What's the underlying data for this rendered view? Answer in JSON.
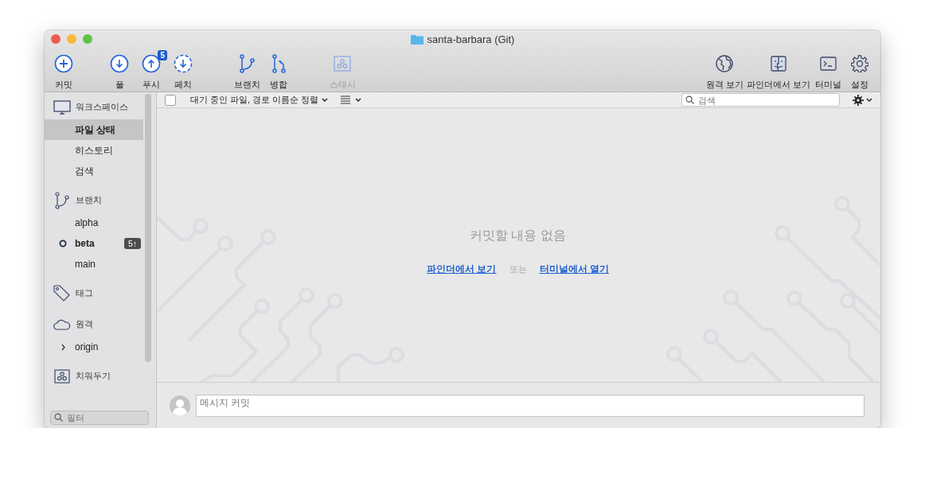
{
  "window": {
    "title": "santa-barbara (Git)"
  },
  "toolbar": {
    "left_groups": [
      [
        {
          "kind": "commit",
          "label": "커밋",
          "disabled": false
        }
      ],
      [
        {
          "kind": "pull",
          "label": "풀",
          "disabled": false
        },
        {
          "kind": "push",
          "label": "푸시",
          "badge": "5",
          "disabled": false
        },
        {
          "kind": "fetch",
          "label": "페치",
          "disabled": false
        }
      ],
      [
        {
          "kind": "branch",
          "label": "브랜치",
          "disabled": false
        },
        {
          "kind": "merge",
          "label": "병합",
          "disabled": false
        }
      ],
      [
        {
          "kind": "stash",
          "label": "스태시",
          "disabled": true
        }
      ]
    ],
    "right": [
      {
        "kind": "remote",
        "label": "원격 보기"
      },
      {
        "kind": "finder",
        "label": "파인더에서 보기"
      },
      {
        "kind": "terminal",
        "label": "터미널"
      },
      {
        "kind": "settings",
        "label": "설정"
      }
    ]
  },
  "sidebar": {
    "sections": [
      {
        "kind": "workspace",
        "title": "워크스페이스",
        "items": [
          {
            "label": "파일 상태",
            "selected": true
          },
          {
            "label": "히스토리",
            "selected": false
          },
          {
            "label": "검색",
            "selected": false
          }
        ]
      },
      {
        "kind": "branches",
        "title": "브랜치",
        "items": [
          {
            "label": "alpha",
            "selected": false,
            "current": false
          },
          {
            "label": "beta",
            "selected": false,
            "current": true,
            "badge": "5↑"
          },
          {
            "label": "main",
            "selected": false,
            "current": false
          }
        ]
      },
      {
        "kind": "tags",
        "title": "태그"
      },
      {
        "kind": "remotes",
        "title": "원격",
        "items": [
          {
            "label": "origin",
            "selected": false,
            "expanded": false
          }
        ]
      },
      {
        "kind": "stashes",
        "title": "치워두기"
      }
    ],
    "filter": {
      "placeholder": "필터"
    }
  },
  "file_bar": {
    "select_all": {
      "checked": false
    },
    "sort": "대기 중인 파일, 경로 이름순 정렬",
    "search": {
      "placeholder": "검색"
    }
  },
  "empty_state": {
    "title": "커밋할 내용 없음",
    "link_1": "파인더에서 보기",
    "separator": "또는",
    "link_2": "터미널에서 열기"
  },
  "commit_box": {
    "placeholder": "메시지 커밋"
  }
}
